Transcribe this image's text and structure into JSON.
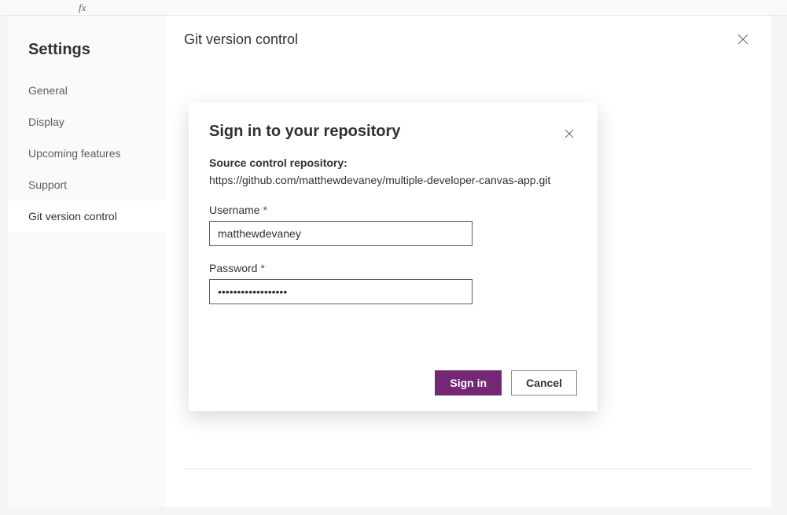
{
  "bg": {
    "fx": "fx"
  },
  "sidebar": {
    "title": "Settings",
    "items": [
      {
        "label": "General"
      },
      {
        "label": "Display"
      },
      {
        "label": "Upcoming features"
      },
      {
        "label": "Support"
      },
      {
        "label": "Git version control"
      }
    ],
    "active_index": 4
  },
  "main": {
    "title": "Git version control"
  },
  "modal": {
    "title": "Sign in to your repository",
    "repo_label": "Source control repository:",
    "repo_url": "https://github.com/matthewdevaney/multiple-developer-canvas-app.git",
    "username_label": "Username",
    "username_value": "matthewdevaney",
    "password_label": "Password",
    "password_value": "••••••••••••••••••",
    "required_marker": "*",
    "signin_label": "Sign in",
    "cancel_label": "Cancel"
  }
}
